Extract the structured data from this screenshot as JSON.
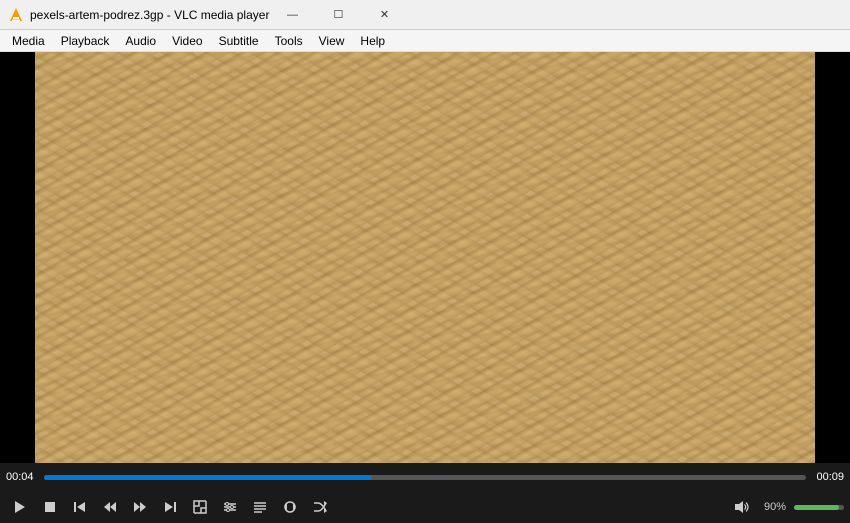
{
  "titlebar": {
    "icon": "vlc",
    "title": "pexels-artem-podrez.3gp - VLC media player",
    "minimize": "—",
    "maximize": "☐",
    "close": "✕"
  },
  "menubar": {
    "items": [
      "Media",
      "Playback",
      "Audio",
      "Video",
      "Subtitle",
      "Tools",
      "View",
      "Help"
    ]
  },
  "controls": {
    "time_current": "00:04",
    "time_total": "00:09",
    "progress_pct": 43,
    "volume_pct": 90,
    "volume_label": "90%"
  },
  "buttons": {
    "play": "▶",
    "stop": "⏹",
    "prev": "⏮",
    "next_frame": "⏭",
    "skip_back": "⏪",
    "skip_fwd": "⏩",
    "fullscreen": "⛶",
    "extended": "⧉",
    "playlist": "☰",
    "loop": "↻",
    "random": "⤢",
    "volume": "🔊"
  }
}
